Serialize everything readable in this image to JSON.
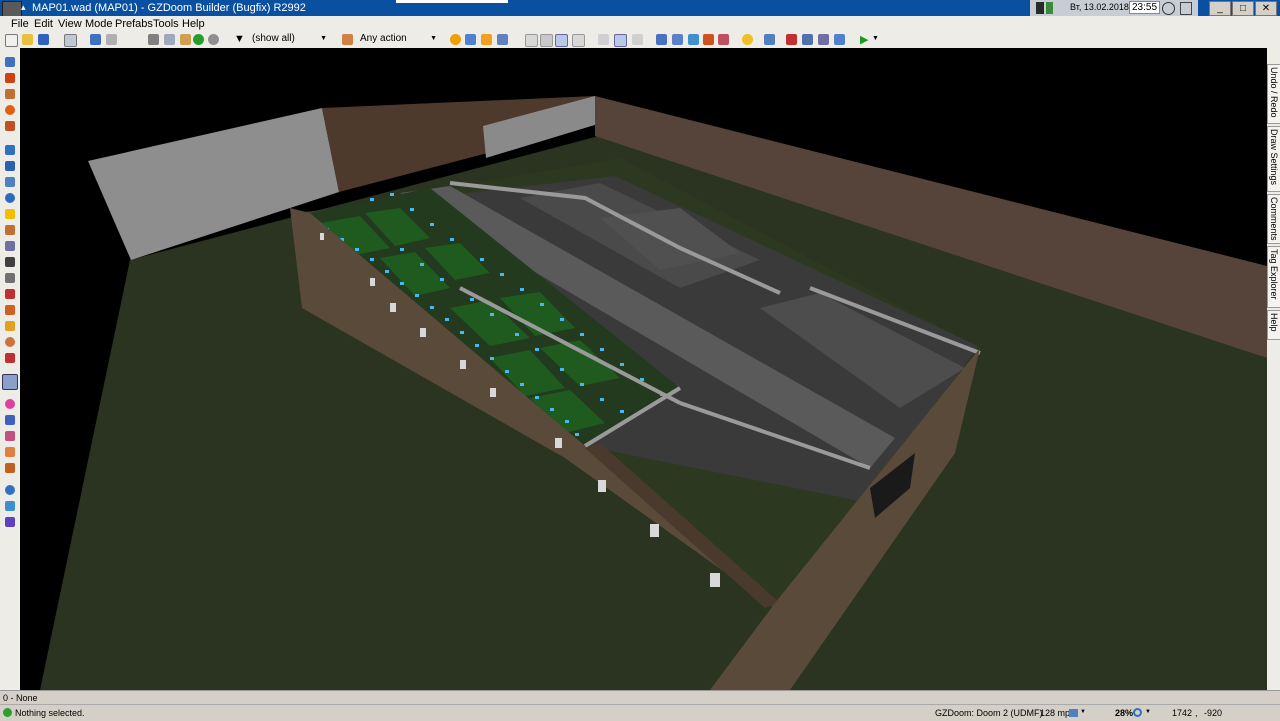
{
  "window": {
    "title": "MAP01.wad (MAP01) - GZDoom Builder (Bugfix) R2992",
    "tray_date": "Вт, 13.02.2018",
    "tray_time": "23:55"
  },
  "menu": [
    "File",
    "Edit",
    "View",
    "Mode",
    "Prefabs",
    "Tools",
    "Help"
  ],
  "toolbar": {
    "filter_value": "(show all)",
    "action_value": "Any action"
  },
  "right_dock": [
    "Undo / Redo",
    "Draw Settings",
    "Comments",
    "Tag Explorer",
    "Help"
  ],
  "info_line": "0 - None",
  "status": {
    "message": "Nothing selected.",
    "game_config": "GZDoom: Doom 2 (UDMF)",
    "grid_size": "128 mp",
    "zoom": "28%",
    "coord_x": "1742",
    "coord_y": "-920"
  },
  "colors": {
    "titlebar": "#0a50a0",
    "brick": "#5a4a3a",
    "floor": "#2d3820",
    "corridor": "#555555",
    "light": "#48b8f0",
    "plant": "#1f5a1f"
  }
}
